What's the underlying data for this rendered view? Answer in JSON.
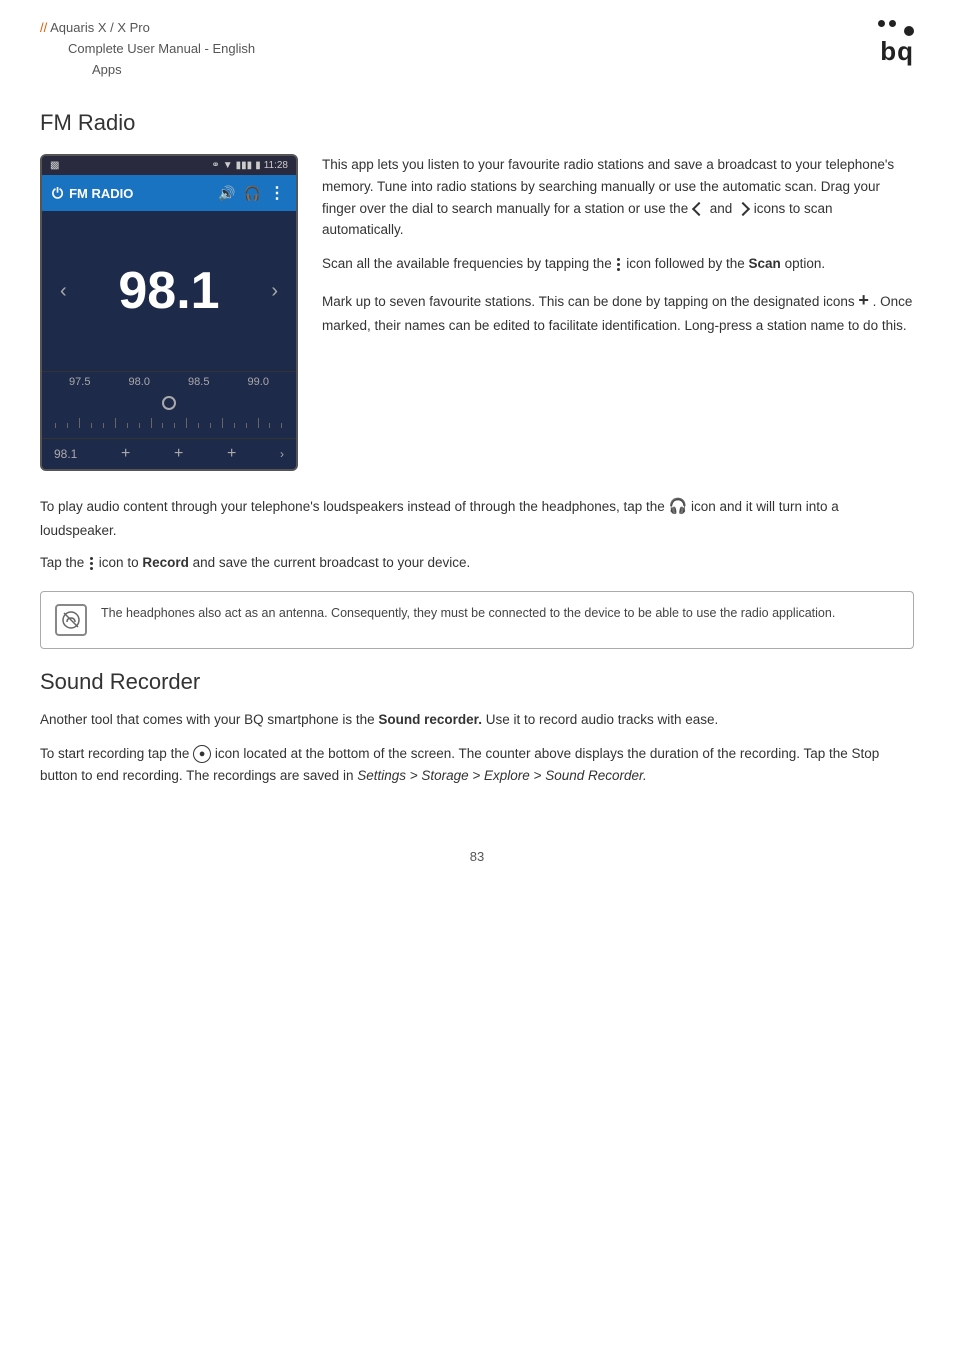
{
  "header": {
    "line1_comment": "//",
    "line1_text": " Aquaris X / X Pro",
    "line2": "Complete User Manual - English",
    "line3": "Apps"
  },
  "logo": {
    "wordmark": "bq"
  },
  "fm_radio": {
    "section_title": "FM Radio",
    "phone": {
      "status_time": "11:28",
      "app_label": "FM RADIO",
      "frequency": "98.1",
      "scale_values": [
        "97.5",
        "98.0",
        "98.5",
        "99.0"
      ],
      "bottom_freq": "98.1"
    },
    "description_p1": "This app lets you listen to your favourite radio stations and save a broadcast to your telephone's memory. Tune into radio stations by searching manually or use the automatic scan. Drag your finger over the dial to search manually for a station or use the",
    "description_and": "and",
    "description_p1_end": "icons to scan automatically.",
    "description_p2_start": "Scan all the available frequencies by tapping the",
    "description_p2_bold": "icon",
    "description_p2_end": "followed by the",
    "description_p2_scan": "Scan",
    "description_p2_finish": "option.",
    "description_p3": "Mark up to seven favourite stations. This can be done by tapping on the designated icons",
    "description_p3_end": ". Once marked, their names can be edited to facilitate identification. Long-press a station name to do this."
  },
  "below_fm": {
    "para1_start": "To play audio content through your telephone's loudspeakers instead of through the headphones, tap the",
    "para1_end": "icon and it will turn into a loudspeaker.",
    "para2_start": "Tap the",
    "para2_bold": "icon to",
    "para2_bold2": "Record",
    "para2_end": "and save the current broadcast to your device."
  },
  "note": {
    "text": "The headphones also act as an antenna. Consequently, they must be connected to the device to be able to use the radio application."
  },
  "sound_recorder": {
    "section_title": "Sound Recorder",
    "para1_start": "Another tool that comes with your BQ smartphone is the",
    "para1_bold": "Sound recorder.",
    "para1_end": "Use it to record audio tracks with ease.",
    "para2_start": "To start recording tap the",
    "para2_end": "icon located at the bottom of the screen. The counter above displays the duration of the recording. Tap the Stop button to end recording. The recordings are saved in",
    "para2_path": "Settings > Storage > Explore > Sound Recorder."
  },
  "page_number": "83"
}
